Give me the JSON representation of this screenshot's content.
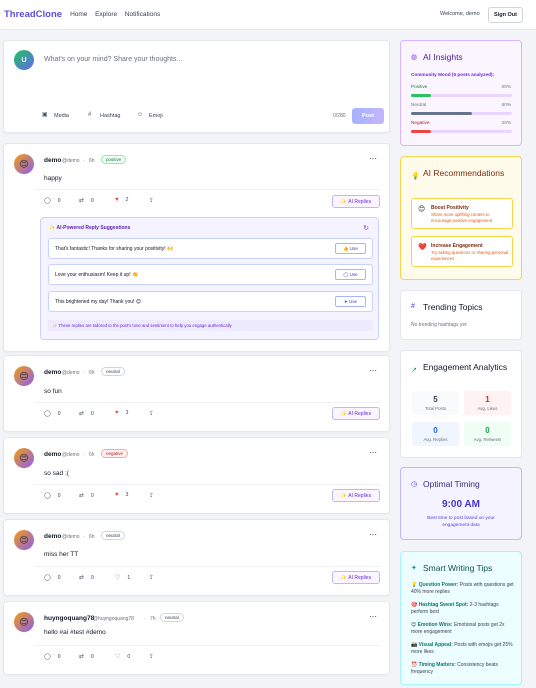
{
  "header": {
    "brand": "ThreadClone",
    "nav": [
      "Home",
      "Explore",
      "Notifications"
    ],
    "welcome": "Welcome, demo",
    "signout": "Sign Out"
  },
  "composer": {
    "avatar": "U",
    "placeholder": "What's on your mind? Share your thoughts...",
    "tools": [
      "Media",
      "Hashtag",
      "Emoji"
    ],
    "char_count": "0/280",
    "post_label": "Post"
  },
  "posts": [
    {
      "name": "demo",
      "handle": "@demo",
      "time": "6h",
      "sentiment": "positive",
      "text": "happy",
      "comments": "0",
      "reposts": "0",
      "likes": "2",
      "ai_label": "AI Replies"
    },
    {
      "name": "demo",
      "handle": "@demo",
      "time": "6h",
      "sentiment": "neutral",
      "text": "so fun",
      "comments": "0",
      "reposts": "0",
      "likes": "3",
      "ai_label": "AI Replies"
    },
    {
      "name": "demo",
      "handle": "@demo",
      "time": "6h",
      "sentiment": "negative",
      "text": "so sad :(",
      "comments": "0",
      "reposts": "0",
      "likes": "3",
      "ai_label": "AI Replies"
    },
    {
      "name": "demo",
      "handle": "@demo",
      "time": "6h",
      "sentiment": "neutral",
      "text": "miss her TT",
      "comments": "0",
      "reposts": "0",
      "likes": "1",
      "ai_label": "AI Replies"
    },
    {
      "name": "huyngoquang78",
      "handle": "@huyngoquang78",
      "time": "7h",
      "sentiment": "neutral",
      "text": "hello #ai #test #demo",
      "comments": "0",
      "reposts": "0",
      "likes": "0"
    }
  ],
  "reply_suggestions": {
    "title": "AI-Powered Reply Suggestions",
    "items": [
      "That's fantastic! Thanks for sharing your positivity! 🙌",
      "Love your enthusiasm! Keep it up! 👏",
      "This brightened my day! Thank you! 😊"
    ],
    "use_label": "Use",
    "note": "These replies are tailored to the post's tone and sentiment to help you engage authentically"
  },
  "insights": {
    "title": "AI Insights",
    "subtitle": "Community Mood (5 posts analyzed):",
    "mood": [
      {
        "label": "Positive",
        "value": "20%",
        "fraction": 0.2,
        "color": "#22c55e"
      },
      {
        "label": "Neutral",
        "value": "60%",
        "fraction": 0.6,
        "color": "#64748b"
      },
      {
        "label": "Negative",
        "value": "20%",
        "fraction": 0.2,
        "color": "#ef4444"
      }
    ]
  },
  "recommendations": {
    "title": "AI Recommendations",
    "items": [
      {
        "title": "Boost Positivity",
        "desc": "Share more uplifting content to encourage positive engagement",
        "icon": "😊"
      },
      {
        "title": "Increase Engagement",
        "desc": "Try asking questions or sharing personal experiences",
        "icon": "❤️"
      }
    ]
  },
  "trending": {
    "title": "Trending Topics",
    "empty": "No trending hashtags yet"
  },
  "analytics": {
    "title": "Engagement Analytics",
    "stats": [
      {
        "value": "5",
        "label": "Total Posts",
        "color": "#374151",
        "bg": "#f9fafb"
      },
      {
        "value": "1",
        "label": "Avg. Likes",
        "color": "#dc2626",
        "bg": "#fef2f2"
      },
      {
        "value": "0",
        "label": "Avg. Replies",
        "color": "#2563eb",
        "bg": "#eff6ff"
      },
      {
        "value": "0",
        "label": "Avg. Retweets",
        "color": "#16a34a",
        "bg": "#f0fdf4"
      }
    ]
  },
  "timing": {
    "title": "Optimal Timing",
    "time": "9:00 AM",
    "desc": "Best time to post based on your engagement data"
  },
  "tips": {
    "title": "Smart Writing Tips",
    "items": [
      {
        "icon": "💡",
        "bold": "Question Power:",
        "text": " Posts with questions get 40% more replies"
      },
      {
        "icon": "🎯",
        "bold": "Hashtag Sweet Spot:",
        "text": " 2-3 hashtags perform best"
      },
      {
        "icon": "😊",
        "bold": "Emotion Wins:",
        "text": " Emotional posts get 2x more engagement"
      },
      {
        "icon": "📸",
        "bold": "Visual Appeal:",
        "text": " Posts with emojis get 25% more likes"
      },
      {
        "icon": "⏰",
        "bold": "Timing Matters:",
        "text": " Consistency beats frequency"
      }
    ]
  }
}
